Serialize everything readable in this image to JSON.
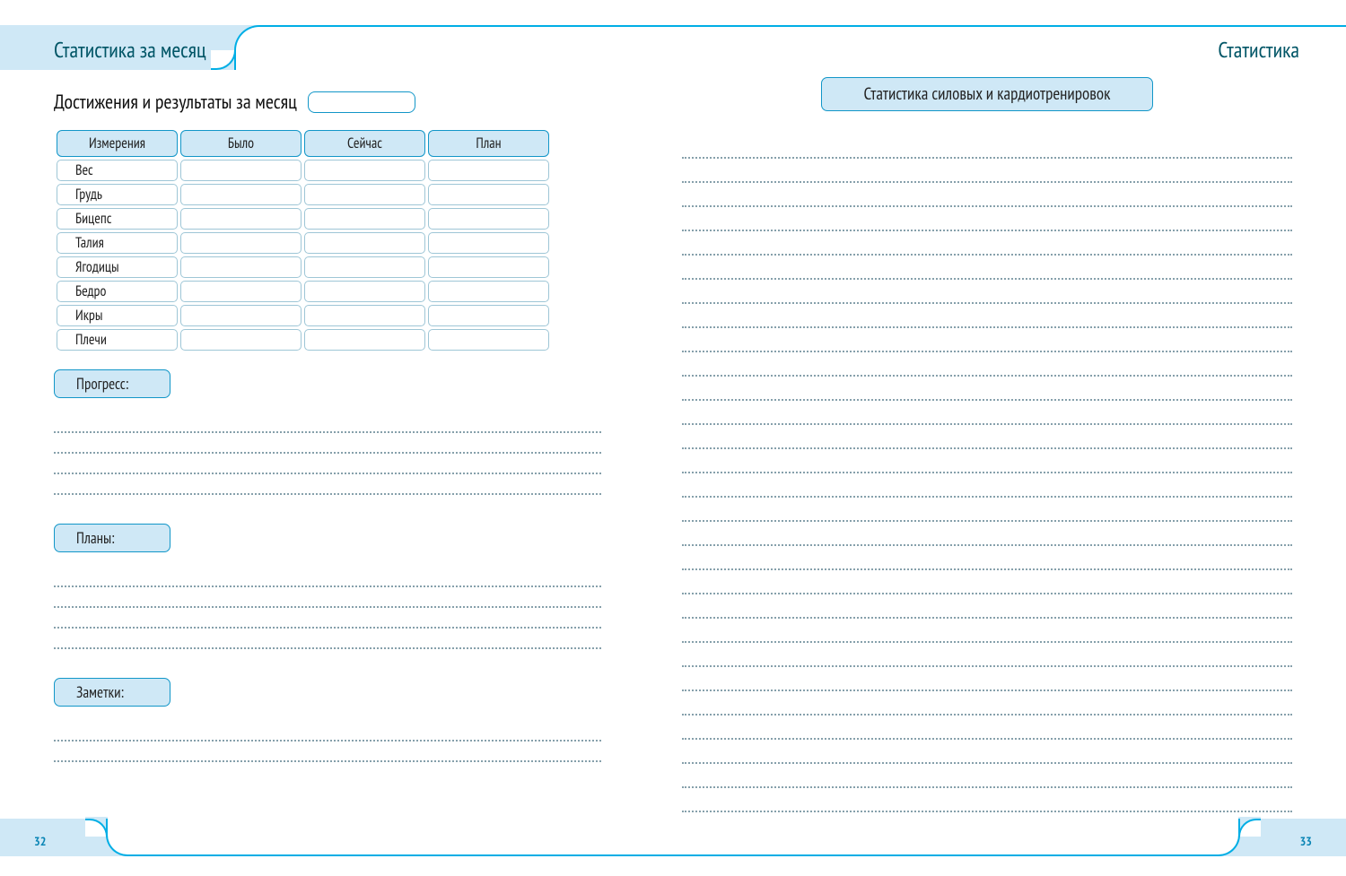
{
  "tabs": {
    "left_title": "Статистика за месяц",
    "right_title": "Статистика"
  },
  "left_page": {
    "heading": "Достижения и результаты за месяц",
    "month_value": "",
    "table": {
      "headers": [
        "Измерения",
        "Было",
        "Сейчас",
        "План"
      ],
      "rows": [
        {
          "label": "Вес",
          "was": "",
          "now": "",
          "plan": ""
        },
        {
          "label": "Грудь",
          "was": "",
          "now": "",
          "plan": ""
        },
        {
          "label": "Бицепс",
          "was": "",
          "now": "",
          "plan": ""
        },
        {
          "label": "Талия",
          "was": "",
          "now": "",
          "plan": ""
        },
        {
          "label": "Ягодицы",
          "was": "",
          "now": "",
          "plan": ""
        },
        {
          "label": "Бедро",
          "was": "",
          "now": "",
          "plan": ""
        },
        {
          "label": "Икры",
          "was": "",
          "now": "",
          "plan": ""
        },
        {
          "label": "Плечи",
          "was": "",
          "now": "",
          "plan": ""
        }
      ]
    },
    "sections": {
      "progress_label": "Прогресс:",
      "plans_label": "Планы:",
      "notes_label": "Заметки:"
    }
  },
  "right_page": {
    "heading": "Статистика силовых и кардиотренировок"
  },
  "page_numbers": {
    "left": "32",
    "right": "33"
  },
  "colors": {
    "accent": "#00aee5",
    "light": "#cfe8f6"
  }
}
